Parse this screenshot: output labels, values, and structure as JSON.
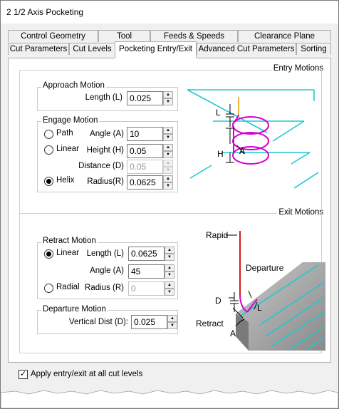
{
  "window": {
    "title": "2 1/2 Axis Pocketing"
  },
  "tabs_row1": [
    "Control Geometry",
    "Tool",
    "Feeds & Speeds",
    "Clearance Plane"
  ],
  "tabs_row2": [
    "Cut Parameters",
    "Cut Levels",
    "Pocketing Entry/Exit",
    "Advanced Cut Parameters",
    "Sorting"
  ],
  "selected_tab": "Pocketing Entry/Exit",
  "entry": {
    "section_label": "Entry Motions",
    "approach": {
      "group_label": "Approach Motion",
      "length_label": "Length (L)",
      "length_value": "0.025"
    },
    "engage": {
      "group_label": "Engage Motion",
      "radio_path": "Path",
      "radio_linear": "Linear",
      "radio_helix": "Helix",
      "selected": "Helix",
      "angle_label": "Angle (A)",
      "angle_value": "10",
      "height_label": "Height (H)",
      "height_value": "0.05",
      "distance_label": "Distance (D)",
      "distance_value": "0.05",
      "radius_label": "Radius(R)",
      "radius_value": "0.0625"
    },
    "diagram": {
      "label_L": "L",
      "label_H": "H",
      "label_A": "A"
    }
  },
  "exit": {
    "section_label": "Exit Motions",
    "retract": {
      "group_label": "Retract Motion",
      "radio_linear": "Linear",
      "radio_radial": "Radial",
      "selected": "Linear",
      "length_label": "Length (L)",
      "length_value": "0.0625",
      "angle_label": "Angle (A)",
      "angle_value": "45",
      "radius_label": "Radius (R)",
      "radius_value": "0"
    },
    "departure": {
      "group_label": "Departure Motion",
      "vdist_label": "Vertical Dist (D):",
      "vdist_value": "0.025"
    },
    "diagram": {
      "rapid": "Rapid",
      "departure": "Departure",
      "retract": "Retract",
      "label_D": "D",
      "label_L": "L",
      "label_A": "A"
    }
  },
  "footer": {
    "checkbox_label": "Apply entry/exit at all cut levels",
    "checked": true
  },
  "colors": {
    "cyan": "#1ec8d2",
    "magenta": "#d400d4",
    "red": "#d00000",
    "orange": "#e8a000"
  },
  "icons": {
    "spin_up": "▲",
    "spin_down": "▼",
    "check": "✓"
  }
}
